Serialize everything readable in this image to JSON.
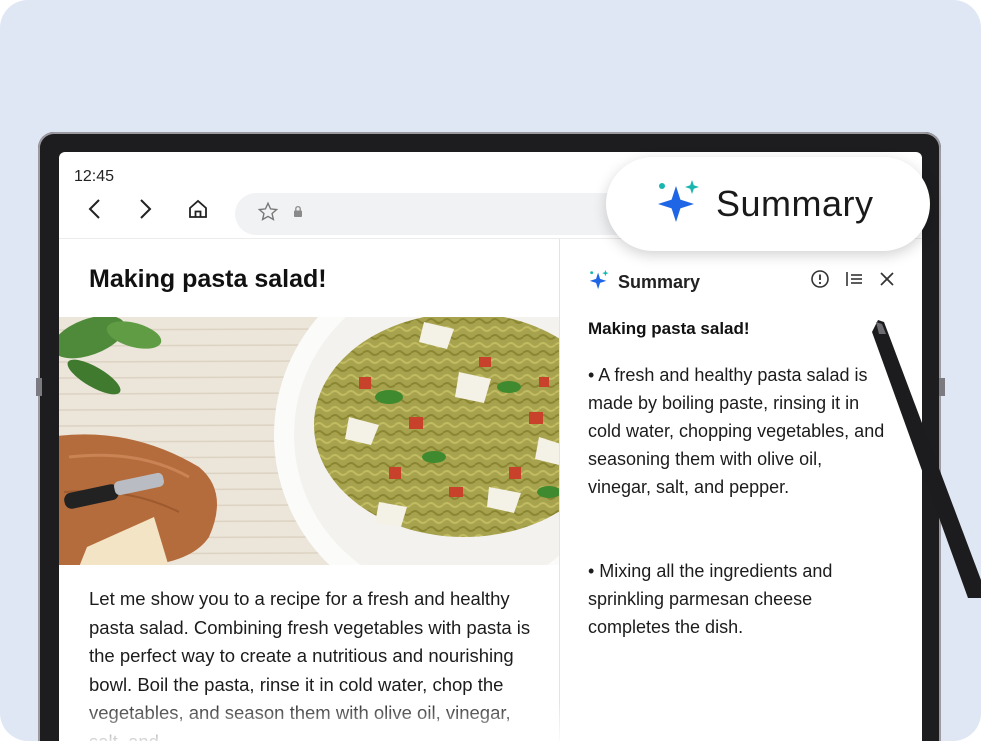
{
  "status": {
    "time": "12:45"
  },
  "browser": {
    "nav": {
      "back_icon": "chevron-left-icon",
      "forward_icon": "chevron-right-icon",
      "home_icon": "home-icon"
    },
    "url_bar": {
      "bookmark_icon": "star-icon",
      "lock_icon": "lock-icon"
    }
  },
  "summary_pill": {
    "label": "Summary",
    "icon": "sparkle-icon"
  },
  "article": {
    "title": "Making pasta salad!",
    "image": "pasta-salad-photo",
    "body": "Let me show you to a recipe for a fresh and healthy pasta salad. Combining fresh vegetables with pasta is the perfect way to create a nutritious and nourishing bowl. Boil the pasta, rinse it in cold water, chop the vegetables, and season them with olive oil, vinegar, salt, and"
  },
  "summary_panel": {
    "header": "Summary",
    "actions": [
      "info-icon",
      "outline-list-icon",
      "close-icon"
    ],
    "title": "Making pasta salad!",
    "bullets": [
      "• A fresh and healthy pasta salad is made by boiling paste, rinsing it in cold water, chopping vegetables, and seasoning them with olive oil, vinegar, salt, and pepper.",
      "• Mixing all the ingredients and sprinkling parmesan cheese completes the dish."
    ]
  },
  "colors": {
    "background": "#dfe7f5",
    "sparkle_blue": "#1e66e6",
    "sparkle_teal": "#19b6b0"
  }
}
